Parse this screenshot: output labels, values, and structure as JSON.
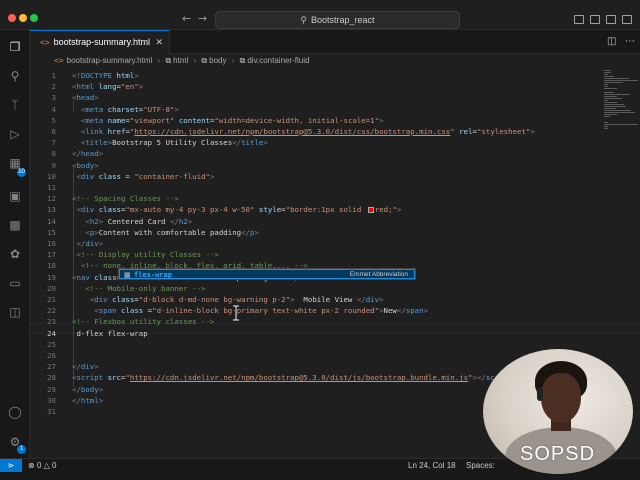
{
  "window": {
    "search_text": "Bootstrap_react",
    "colors": {
      "accent": "#0078d4",
      "background": "#1f1f1f"
    }
  },
  "activity_bar": {
    "items": [
      {
        "icon": "files-icon"
      },
      {
        "icon": "search-icon"
      },
      {
        "icon": "source-control-icon"
      },
      {
        "icon": "run-debug-icon"
      },
      {
        "icon": "extensions-icon",
        "badge": "10"
      },
      {
        "icon": "remote-explorer-icon"
      },
      {
        "icon": "testing-icon"
      },
      {
        "icon": "python-icon"
      },
      {
        "icon": "docker-icon"
      },
      {
        "icon": "project-manager-icon"
      }
    ],
    "account_icon": "account-icon",
    "settings_icon": "settings-icon",
    "settings_badge": "1"
  },
  "tab": {
    "label": "bootstrap-summary.html",
    "close_icon": "close-icon"
  },
  "breadcrumb": [
    "bootstrap-summary.html",
    "html",
    "body",
    "div.container-fluid"
  ],
  "editor": {
    "current_line": 24,
    "lines": [
      {
        "n": "1",
        "html": "<span class='t-pun'>&lt;!</span><span class='t-tag'>DOCTYPE</span> <span class='t-attr'>html</span><span class='t-pun'>&gt;</span>"
      },
      {
        "n": "2",
        "html": "<span class='t-pun'>&lt;</span><span class='t-tag'>html</span> <span class='t-attr'>lang</span>=<span class='t-str'>\"en\"</span><span class='t-pun'>&gt;</span>"
      },
      {
        "n": "3",
        "html": "<span class='t-pun'>&lt;</span><span class='t-tag'>head</span><span class='t-pun'>&gt;</span>"
      },
      {
        "n": "4",
        "html": "  <span class='t-pun'>&lt;</span><span class='t-tag'>meta</span> <span class='t-attr'>charset</span>=<span class='t-str'>\"UTF-8\"</span><span class='t-pun'>&gt;</span>"
      },
      {
        "n": "5",
        "html": "  <span class='t-pun'>&lt;</span><span class='t-tag'>meta</span> <span class='t-attr'>name</span>=<span class='t-str'>\"viewport\"</span> <span class='t-attr'>content</span>=<span class='t-str'>\"width=device-width, initial-scale=1\"</span><span class='t-pun'>&gt;</span>"
      },
      {
        "n": "6",
        "html": "  <span class='t-pun'>&lt;</span><span class='t-tag'>link</span> <span class='t-attr'>href</span>=<span class='t-str'>\"</span><span class='t-url'>https://cdn.jsdelivr.net/npm/bootstrap@5.3.0/dist/css/bootstrap.min.css</span><span class='t-str'>\"</span> <span class='t-attr'>rel</span>=<span class='t-str'>\"stylesheet\"</span><span class='t-pun'>&gt;</span>"
      },
      {
        "n": "7",
        "html": "  <span class='t-pun'>&lt;</span><span class='t-tag'>title</span><span class='t-pun'>&gt;</span><span class='t-txt'>Bootstrap 5 Utility Classes</span><span class='t-pun'>&lt;/</span><span class='t-tag'>title</span><span class='t-pun'>&gt;</span>"
      },
      {
        "n": "8",
        "html": "<span class='t-pun'>&lt;/</span><span class='t-tag'>head</span><span class='t-pun'>&gt;</span>"
      },
      {
        "n": "9",
        "html": "<span class='t-pun'>&lt;</span><span class='t-tag'>body</span><span class='t-pun'>&gt;</span>"
      },
      {
        "n": "10",
        "html": " <span class='t-pun'>&lt;</span><span class='t-tag'>div</span> <span class='t-attr'>class</span> = <span class='t-str'>\"container-fluid\"</span><span class='t-pun'>&gt;</span>"
      },
      {
        "n": "11",
        "html": ""
      },
      {
        "n": "12",
        "html": "<span class='t-cm'>&lt;!-- Spacing Classes --&gt;</span>"
      },
      {
        "n": "13",
        "html": " <span class='t-pun'>&lt;</span><span class='t-tag'>div</span> <span class='t-attr'>class</span>=<span class='t-str'>\"mx-auto my-4 py-3 px-4 w-50\"</span> <span class='t-attr'>style</span>=<span class='t-str'>\"border:1px solid <span class='swatch'></span>red;\"</span><span class='t-pun'>&gt;</span>"
      },
      {
        "n": "14",
        "html": "   <span class='t-pun'>&lt;</span><span class='t-tag'>h2</span><span class='t-pun'>&gt;</span><span class='t-txt'> Centered Card </span><span class='t-pun'>&lt;/</span><span class='t-tag'>h2</span><span class='t-pun'>&gt;</span>"
      },
      {
        "n": "15",
        "html": "   <span class='t-pun'>&lt;</span><span class='t-tag'>p</span><span class='t-pun'>&gt;</span><span class='t-txt'>Content with comfortable padding</span><span class='t-pun'>&lt;/</span><span class='t-tag'>p</span><span class='t-pun'>&gt;</span>"
      },
      {
        "n": "16",
        "html": " <span class='t-pun'>&lt;/</span><span class='t-tag'>div</span><span class='t-pun'>&gt;</span>"
      },
      {
        "n": "17",
        "html": " <span class='t-cm'>&lt;!-- Display utility Classes --&gt;</span>"
      },
      {
        "n": "18",
        "html": "  <span class='t-cm'>&lt;!-- none, inline, block, flex, grid, table.... --&gt;</span>"
      },
      {
        "n": "19",
        "html": "<span class='t-pun'>&lt;</span><span class='t-tag'>nav</span> <span class='t-attr'>class</span>=<span class='t-str'>\"d-none d-md-block\"</span><span class='t-pun'>&gt;</span><span class='t-txt'>Desktop Navigation</span><span class='t-pun'>&lt;/</span><span class='t-tag'>nav</span><span class='t-pun'>&gt;</span>"
      },
      {
        "n": "20",
        "html": "   <span class='t-cm'>&lt;!-- Mobile-only banner --&gt;</span>"
      },
      {
        "n": "21",
        "html": "    <span class='t-pun'>&lt;</span><span class='t-tag'>div</span> <span class='t-attr'>class</span>=<span class='t-str'>\"d-block d-md-none bg-warning p-2\"</span><span class='t-pun'>&gt;</span><span class='t-txt'>  Mobile View </span><span class='t-pun'>&lt;/</span><span class='t-tag'>div</span><span class='t-pun'>&gt;</span>"
      },
      {
        "n": "22",
        "html": "     <span class='t-pun'>&lt;</span><span class='t-tag'>span</span> <span class='t-attr'>class</span> =<span class='t-str'>\"d-inline-block bg-primary text-white px-2 rounded\"</span><span class='t-pun'>&gt;</span><span class='t-txt'>New</span><span class='t-pun'>&lt;/</span><span class='t-tag'>span</span><span class='t-pun'>&gt;</span>"
      },
      {
        "n": "23",
        "html": "<span class='t-cm'>&lt;!-- Flexbox utility classes --&gt;</span>"
      },
      {
        "n": "24",
        "html": " <span class='t-txt'>d-flex flex-wrap</span>"
      },
      {
        "n": "25",
        "html": ""
      },
      {
        "n": "26",
        "html": ""
      },
      {
        "n": "27",
        "html": "<span class='t-pun'>&lt;/</span><span class='t-tag'>div</span><span class='t-pun'>&gt;</span>"
      },
      {
        "n": "28",
        "html": "<span class='t-pun'>&lt;</span><span class='t-tag'>script</span> <span class='t-attr'>src</span>=<span class='t-str'>\"</span><span class='t-url'>https://cdn.jsdelivr.net/npm/bootstrap@5.3.0/dist/js/bootstrap.bundle.min.js</span><span class='t-str'>\"</span><span class='t-pun'>&gt;&lt;/</span><span class='t-tag'>sc</span>"
      },
      {
        "n": "29",
        "html": "<span class='t-pun'>&lt;/</span><span class='t-tag'>body</span><span class='t-pun'>&gt;</span>"
      },
      {
        "n": "30",
        "html": "<span class='t-pun'>&lt;/</span><span class='t-tag'>html</span><span class='t-pun'>&gt;</span>"
      },
      {
        "n": "31",
        "html": ""
      }
    ]
  },
  "suggest": {
    "icon": "abbreviation-icon",
    "match": "flex-wrap",
    "detail": "Emmet Abbreviation"
  },
  "status": {
    "errors": "0",
    "warnings": "0",
    "position": "Ln 24, Col 18",
    "spaces": "Spaces:"
  },
  "webcam": {
    "watermark": "SOPSD"
  }
}
